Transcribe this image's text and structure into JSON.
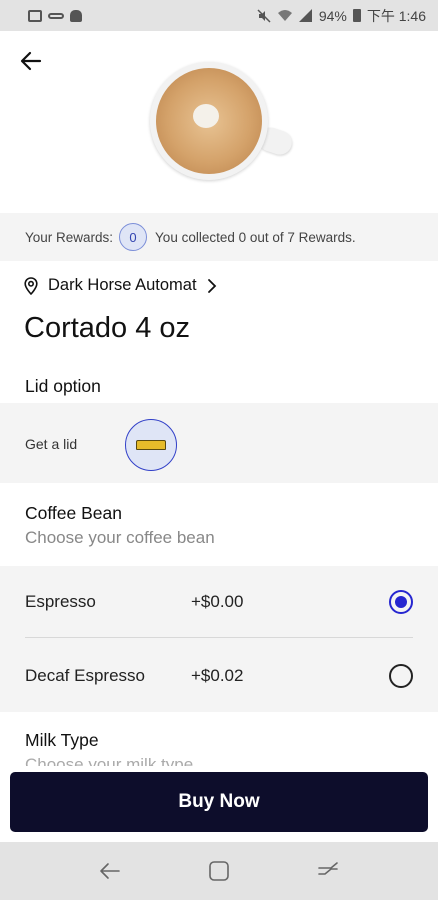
{
  "status_bar": {
    "battery": "94%",
    "time": "下午 1:46"
  },
  "product": {
    "store": "Dark Horse Automat",
    "title": "Cortado 4 oz"
  },
  "rewards": {
    "label": "Your Rewards:",
    "count": "0",
    "message": "You collected 0 out of 7 Rewards."
  },
  "lid": {
    "heading": "Lid option",
    "option_label": "Get a lid",
    "selected": true,
    "lid_color": "#e6bb2a"
  },
  "coffee_bean": {
    "heading": "Coffee Bean",
    "subheading": "Choose your coffee bean",
    "options": [
      {
        "name": "Espresso",
        "price": "+$0.00",
        "selected": true
      },
      {
        "name": "Decaf Espresso",
        "price": "+$0.02",
        "selected": false
      }
    ]
  },
  "milk_type": {
    "heading": "Milk Type",
    "subheading": "Choose your milk type"
  },
  "actions": {
    "buy_label": "Buy Now"
  },
  "colors": {
    "accent": "#2626d0",
    "buy_button": "#0d0d2b",
    "section_bg": "#f4f4f4"
  },
  "icons": [
    "back-arrow-icon",
    "location-pin-icon",
    "chevron-right-icon",
    "radio-selected-icon",
    "radio-unselected-icon",
    "nav-back-icon",
    "nav-home-icon",
    "nav-recents-icon"
  ]
}
